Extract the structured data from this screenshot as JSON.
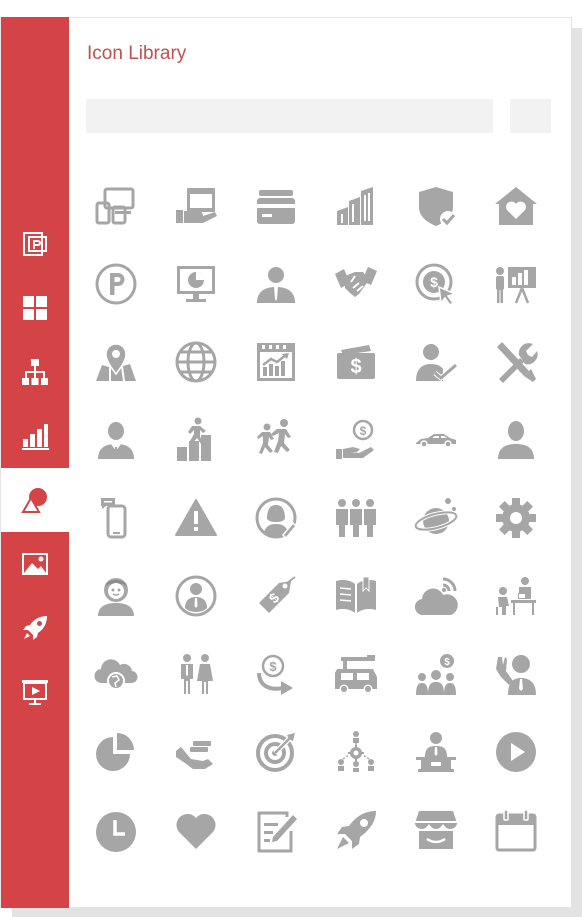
{
  "header": {
    "title": "Icon Library"
  },
  "search": {
    "placeholder": "",
    "value": ""
  },
  "colors": {
    "accent": "#d44346",
    "title": "#c0504d",
    "icon": "#a6a6a6",
    "field": "#f2f2f2"
  },
  "sidebar": {
    "items": [
      {
        "icon": "powerpoint-icon"
      },
      {
        "icon": "layout-grid-icon"
      },
      {
        "icon": "org-chart-icon"
      },
      {
        "icon": "bar-chart-icon"
      },
      {
        "icon": "shapes-icon",
        "active": true
      },
      {
        "icon": "picture-icon"
      },
      {
        "icon": "rocket-icon"
      },
      {
        "icon": "slideshow-icon"
      }
    ]
  },
  "icons": [
    "devices-icon",
    "hand-window-icon",
    "credit-cards-icon",
    "buildings-icon",
    "shield-check-icon",
    "home-heart-icon",
    "parking-icon",
    "monitor-chart-icon",
    "businessman-icon",
    "handshake-icon",
    "dollar-click-icon",
    "presenter-chart-icon",
    "map-pin-icon",
    "globe-icon",
    "calendar-chart-icon",
    "money-icon",
    "person-check-icon",
    "tools-icon",
    "manager-icon",
    "climber-stairs-icon",
    "runners-icon",
    "hand-coin-icon",
    "car-icon",
    "user-icon",
    "phone-message-icon",
    "warning-icon",
    "woman-pen-icon",
    "team-icon",
    "planet-icon",
    "gear-icon",
    "boy-icon",
    "user-circle-icon",
    "price-tag-icon",
    "book-icon",
    "cloud-signal-icon",
    "meeting-icon",
    "cloud-globe-icon",
    "couple-icon",
    "dollar-arrow-icon",
    "truck-icon",
    "group-dollar-icon",
    "waving-person-icon",
    "pie-chart-icon",
    "hand-cash-icon",
    "target-icon",
    "network-gear-icon",
    "speaker-podium-icon",
    "play-icon",
    "clock-icon",
    "heart-icon",
    "edit-note-icon",
    "rocket-icon",
    "store-icon",
    "calendar-icon"
  ]
}
